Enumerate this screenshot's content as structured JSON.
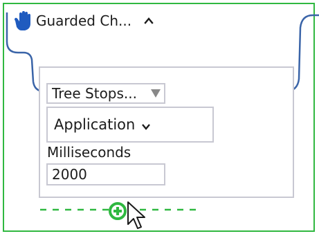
{
  "header": {
    "title": "Guarded Ch...",
    "icon": "hand-icon",
    "toggle_icon": "chevron-up-icon"
  },
  "step": {
    "tree_select": "Tree Stops...",
    "application_dropdown": "Application",
    "milliseconds_label": "Milliseconds",
    "milliseconds_value": "2000"
  },
  "add_step_icon": "plus-circle-icon",
  "colors": {
    "frame": "#2fb840",
    "connector": "#3a64a8",
    "hand": "#1f5bbf",
    "panel_border": "#c8c8d2",
    "add": "#2fb840"
  }
}
